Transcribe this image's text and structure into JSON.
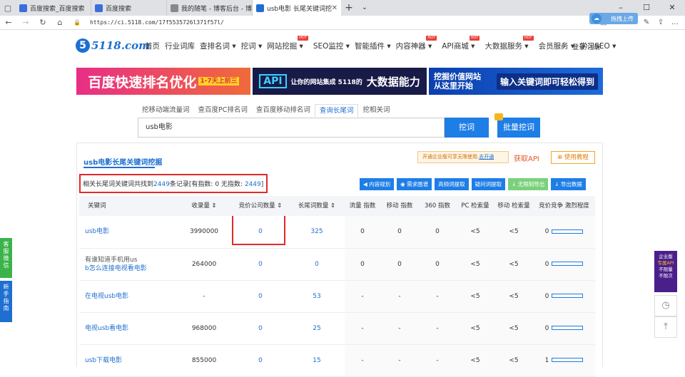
{
  "browser": {
    "tabs": [
      {
        "title": "百度搜索_百度搜索",
        "fav": "#3a6edb"
      },
      {
        "title": "百度搜索",
        "fav": "#3a6edb"
      },
      {
        "title": "我的随笔 - 博客后台 - 博客",
        "fav": "#888888"
      },
      {
        "title": "usb电影 长尾关键词挖掘",
        "fav": "#1e6fd0"
      }
    ],
    "url": "https://ci.5118.com/17f5535726l371f57l/",
    "cloud_label": "拖拽上传"
  },
  "site": {
    "logo": "5118.com",
    "logo_mark": "5",
    "menu": [
      "首页",
      "行业词库",
      "查排名词 ▾",
      "挖词 ▾",
      "网站挖掘 ▾",
      "SEO监控 ▾",
      "智能插件 ▾",
      "内容神器 ▾",
      "API商城 ▾",
      "大数据服务 ▾",
      "会员服务 ▾",
      "学习SEO ▾"
    ],
    "hot_tag": "HOT",
    "login": "登录/注册"
  },
  "banners": {
    "b1": "百度快速排名优化",
    "b1_tag": "1-7天上前三",
    "b2_api": "API",
    "b2_text": "让你的网站集成 5118的",
    "b2_big": "大数据能力",
    "b3_left": "挖掘价值网站 从这里开始",
    "b3_right": "输入关键词即可轻松得到"
  },
  "search": {
    "tabs": [
      "挖移动端流量词",
      "查百度PC排名词",
      "查百度移动排名词",
      "查询长尾词",
      "挖相关词"
    ],
    "value": "usb电影",
    "search_btn": "挖词",
    "batch_btn": "批量挖词"
  },
  "card": {
    "title": "usb电影长尾关键词挖掘",
    "promo": "开通企业版可享无限使用,",
    "promo_link": "去开通",
    "get_api": "获取API",
    "tutorial": "⊕ 使用教程",
    "summary_pre": "相关长尾词关键词共找到",
    "summary_count": "2449",
    "summary_mid": "条记录[有指数: 0  无指数: ",
    "summary_none": "2449",
    "summary_end": "]",
    "actions": [
      "◀ 内容规划",
      "◉ 需求图谱",
      "高频词提取",
      "疑问词提取",
      "↓ 无限制导出",
      "↓ 导出数据"
    ]
  },
  "table": {
    "headers": [
      "关键词",
      "收录量 ⇕",
      "竞价公司数量 ⇕",
      "长尾词数量 ⇕",
      "流量 指数",
      "移动 指数",
      "360 指数",
      "PC 检索量",
      "移动 检索量",
      "竞价竞争 激烈程度"
    ],
    "rows": [
      {
        "kw": "usb电影",
        "kw2": "",
        "included": "3990000",
        "bid": "0",
        "longtail": "325",
        "flow": "0",
        "mobile": "0",
        "s360": "0",
        "pc": "<5",
        "mob": "<5",
        "comp": "0"
      },
      {
        "kw": "有谁知道手机用us",
        "kw2": "b怎么连接电视看电影",
        "included": "264000",
        "bid": "0",
        "longtail": "0",
        "flow": "0",
        "mobile": "0",
        "s360": "0",
        "pc": "<5",
        "mob": "<5",
        "comp": "0"
      },
      {
        "kw": "在电视usb电影",
        "kw2": "",
        "included": "-",
        "bid": "0",
        "longtail": "53",
        "flow": "-",
        "mobile": "-",
        "s360": "-",
        "pc": "<5",
        "mob": "<5",
        "comp": "0"
      },
      {
        "kw": "电视usb看电影",
        "kw2": "",
        "included": "968000",
        "bid": "0",
        "longtail": "25",
        "flow": "-",
        "mobile": "-",
        "s360": "-",
        "pc": "<5",
        "mob": "<5",
        "comp": "0"
      },
      {
        "kw": "usb下载电影",
        "kw2": "",
        "included": "855000",
        "bid": "0",
        "longtail": "15",
        "flow": "-",
        "mobile": "-",
        "s360": "-",
        "pc": "<5",
        "mob": "<5",
        "comp": "1"
      }
    ]
  },
  "side": {
    "left1": "客服微信",
    "left2": "新手指南",
    "right": "企业版",
    "right_api": "专属API",
    "right_sub": "不限量 不限次"
  },
  "colors": {
    "accent": "#1e7ee6",
    "red_box": "#e02a2a"
  }
}
